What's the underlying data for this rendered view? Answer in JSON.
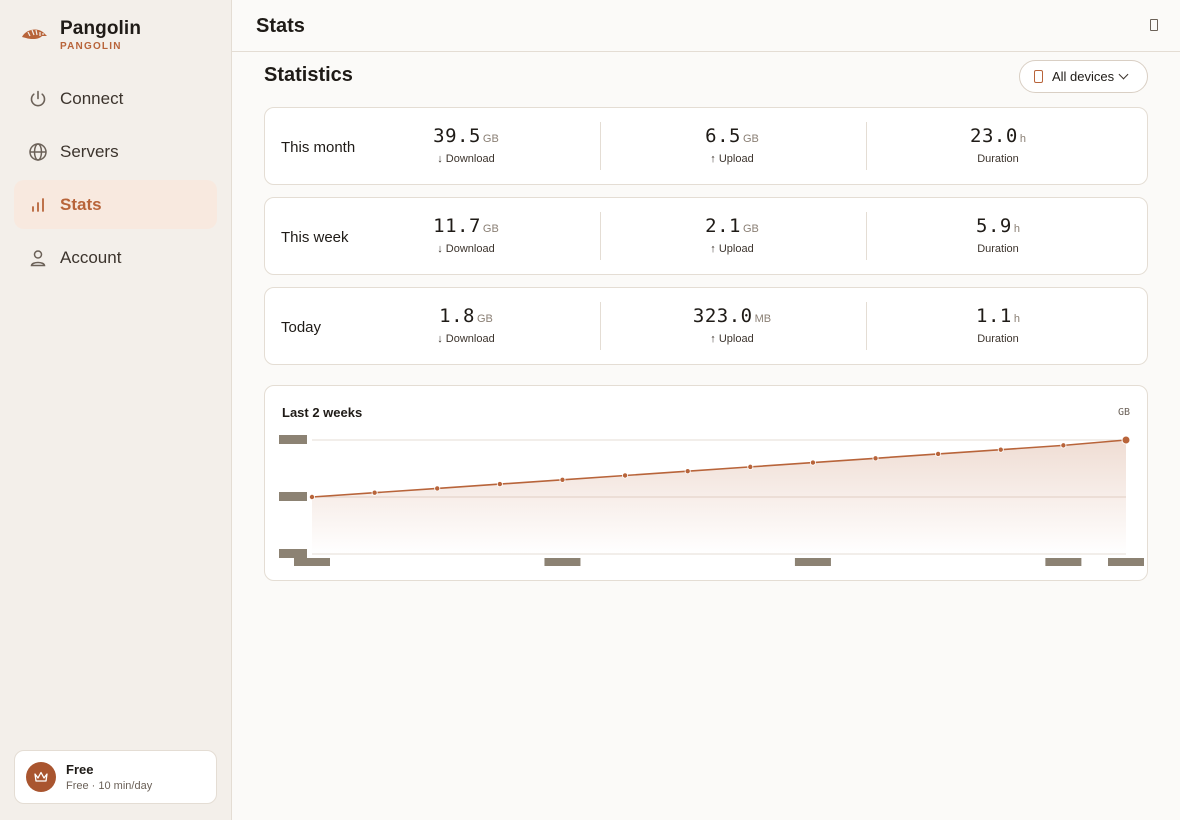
{
  "app": {
    "name": "Pangolin",
    "subtitle": "PANGOLIN"
  },
  "sidebar": {
    "items": [
      {
        "label": "Connect",
        "icon": "power-icon",
        "active": false
      },
      {
        "label": "Servers",
        "icon": "globe-icon",
        "active": false
      },
      {
        "label": "Stats",
        "icon": "bar-chart-icon",
        "active": true
      },
      {
        "label": "Account",
        "icon": "user-icon",
        "active": false
      }
    ],
    "plan": {
      "title": "Free",
      "subtitle": "Free · 10 min/day",
      "icon": "crown-icon"
    }
  },
  "header": {
    "title": "Stats"
  },
  "main": {
    "section_title": "Statistics",
    "device_filter": "All devices",
    "periods": [
      {
        "label": "This month",
        "download": {
          "value": "39.5",
          "unit": "GB",
          "caption": "↓ Download"
        },
        "upload": {
          "value": "6.5",
          "unit": "GB",
          "caption": "↑ Upload"
        },
        "duration": {
          "value": "23.0",
          "unit": "h",
          "caption": "Duration"
        }
      },
      {
        "label": "This week",
        "download": {
          "value": "11.7",
          "unit": "GB",
          "caption": "↓ Download"
        },
        "upload": {
          "value": "2.1",
          "unit": "GB",
          "caption": "↑ Upload"
        },
        "duration": {
          "value": "5.9",
          "unit": "h",
          "caption": "Duration"
        }
      },
      {
        "label": "Today",
        "download": {
          "value": "1.8",
          "unit": "GB",
          "caption": "↓ Download"
        },
        "upload": {
          "value": "323.0",
          "unit": "MB",
          "caption": "↑ Upload"
        },
        "duration": {
          "value": "1.1",
          "unit": "h",
          "caption": "Duration"
        }
      }
    ]
  },
  "colors": {
    "accent": "#b8643a",
    "placeholder": "#8c8273",
    "grid": "#e6dcd4"
  },
  "chart_data": {
    "type": "area",
    "title": "Last 2 weeks",
    "ylabel": "GB",
    "grid": true,
    "points": 14,
    "values": [
      0.53,
      0.57,
      0.61,
      0.65,
      0.69,
      0.73,
      0.77,
      0.81,
      0.85,
      0.89,
      0.93,
      0.97,
      1.01,
      1.06
    ],
    "ylim": [
      0,
      1.06
    ],
    "y_ticks_count": 3,
    "x_tick_indices": [
      0,
      4,
      8,
      12,
      13
    ]
  }
}
